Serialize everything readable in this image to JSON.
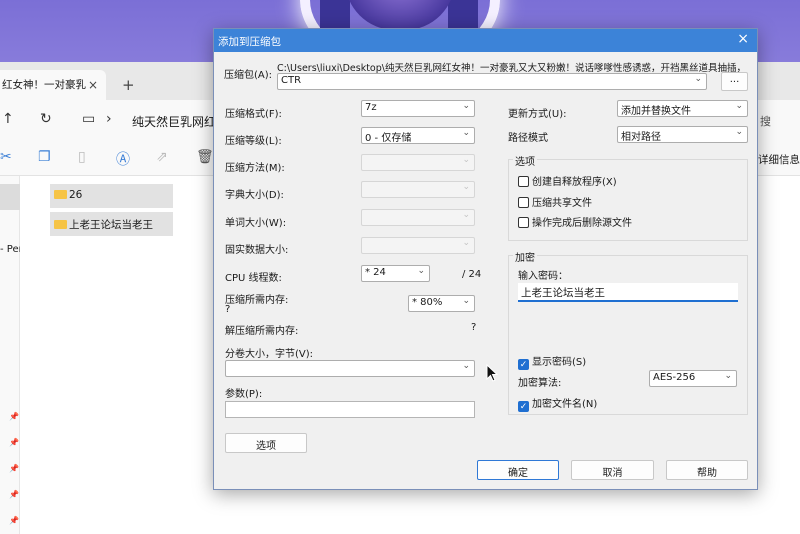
{
  "explorer": {
    "tab_title": "红女神！一对豪乳",
    "new_tab": "+",
    "tab_close": "×",
    "address": "纯天然巨乳网红",
    "search_tail": "搜",
    "detail_info": "详细信息",
    "nav_pane_text": "- Per",
    "files": [
      "26",
      "上老王论坛当老王"
    ]
  },
  "dialog": {
    "title": "添加到压缩包",
    "archive_label": "压缩包(A):",
    "archive_path": "C:\\Users\\liuxi\\Desktop\\纯天然巨乳网红女神！一对豪乳又大又粉嫩！说话嗲嗲性感诱惑，开裆黑丝道具抽插，",
    "archive_name": "CTR",
    "browse_label": "...",
    "format_label": "压缩格式(F):",
    "format_value": "7z",
    "level_label": "压缩等级(L):",
    "level_value": "0 - 仅存储",
    "method_label": "压缩方法(M):",
    "dict_label": "字典大小(D):",
    "word_label": "单词大小(W):",
    "solid_label": "固实数据大小:",
    "threads_label": "CPU 线程数:",
    "threads_value": "* 24",
    "threads_max": "/ 24",
    "mem_label": "压缩所需内存:",
    "mem_value": "?",
    "mem_pct": "* 80%",
    "decomp_label": "解压缩所需内存:",
    "decomp_value": "?",
    "split_label": "分卷大小，字节(V):",
    "params_label": "参数(P):",
    "options_button": "选项",
    "update_label": "更新方式(U):",
    "update_value": "添加并替换文件",
    "path_label": "路径模式",
    "path_value": "相对路径",
    "options_group": "选项",
    "opt_sfx": "创建自释放程序(X)",
    "opt_shared": "压缩共享文件",
    "opt_delete": "操作完成后删除源文件",
    "encrypt_group": "加密",
    "password_label": "输入密码：",
    "password_value": "上老王论坛当老王",
    "show_password": "显示密码(S)",
    "enc_method_label": "加密算法:",
    "enc_method_value": "AES-256",
    "enc_names": "加密文件名(N)",
    "ok": "确定",
    "cancel": "取消",
    "help": "帮助"
  },
  "icons": {
    "close": "×",
    "caret": "⌄",
    "check": "✓"
  }
}
